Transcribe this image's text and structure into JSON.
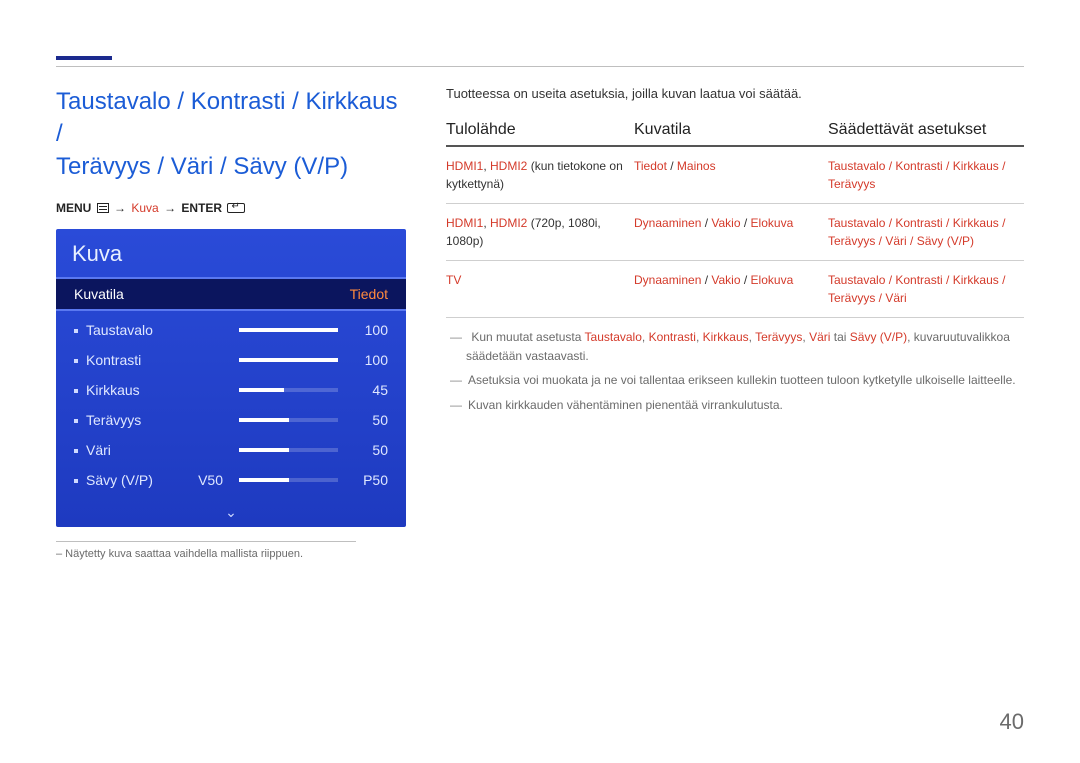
{
  "page_number": "40",
  "left": {
    "title_l1": "Taustavalo / Kontrasti / Kirkkaus /",
    "title_l2": "Terävyys / Väri / Sävy (V/P)",
    "menu_prefix": "MENU",
    "menu_mid": "Kuva",
    "menu_suffix": "ENTER",
    "arrow": "→"
  },
  "osd": {
    "title": "Kuva",
    "header_left": "Kuvatila",
    "header_right": "Tiedot",
    "items": [
      {
        "label": "Taustavalo",
        "pre": "",
        "value": "100",
        "pct": 100
      },
      {
        "label": "Kontrasti",
        "pre": "",
        "value": "100",
        "pct": 100
      },
      {
        "label": "Kirkkaus",
        "pre": "",
        "value": "45",
        "pct": 45
      },
      {
        "label": "Terävyys",
        "pre": "",
        "value": "50",
        "pct": 50
      },
      {
        "label": "Väri",
        "pre": "",
        "value": "50",
        "pct": 50
      },
      {
        "label": "Sävy (V/P)",
        "pre": "V50",
        "value": "P50",
        "pct": 50
      }
    ]
  },
  "panel_footnote": "– Näytetty kuva saattaa vaihdella mallista riippuen.",
  "right": {
    "intro": "Tuotteessa on useita asetuksia, joilla kuvan laatua voi säätää.",
    "headers": {
      "c1": "Tulolähde",
      "c2": "Kuvatila",
      "c3": "Säädettävät asetukset"
    },
    "rows": [
      {
        "c1_hl": "HDMI1",
        "c1_sep1": ", ",
        "c1_hl2": "HDMI2",
        "c1_rest": " (kun tietokone on kytkettynä)",
        "c2_a": "Tiedot",
        "c2_s1": " / ",
        "c2_b": "Mainos",
        "c2_s2": "",
        "c2_c": "",
        "c3": "Taustavalo / Kontrasti / Kirkkaus / Terävyys"
      },
      {
        "c1_hl": "HDMI1",
        "c1_sep1": ", ",
        "c1_hl2": "HDMI2",
        "c1_rest": " (720p, 1080i, 1080p)",
        "c2_a": "Dynaaminen",
        "c2_s1": " / ",
        "c2_b": "Vakio",
        "c2_s2": " / ",
        "c2_c": "Elokuva",
        "c3": "Taustavalo / Kontrasti / Kirkkaus / Terävyys / Väri / Sävy (V/P)"
      },
      {
        "c1_hl": "TV",
        "c1_sep1": "",
        "c1_hl2": "",
        "c1_rest": "",
        "c2_a": "Dynaaminen",
        "c2_s1": " / ",
        "c2_b": "Vakio",
        "c2_s2": " / ",
        "c2_c": "Elokuva",
        "c3": "Taustavalo / Kontrasti / Kirkkaus / Terävyys / Väri"
      }
    ],
    "notes": {
      "n1_a": "Kun muutat asetusta ",
      "n1_b": "Taustavalo",
      "n1_c": ", ",
      "n1_d": "Kontrasti",
      "n1_e": ", ",
      "n1_f": "Kirkkaus",
      "n1_g": ", ",
      "n1_h": "Terävyys",
      "n1_i": ", ",
      "n1_j": "Väri",
      "n1_k": " tai ",
      "n1_l": "Sävy (V/P)",
      "n1_m": ", kuvaruutuvalikkoa säädetään vastaavasti.",
      "n2": "Asetuksia voi muokata ja ne voi tallentaa erikseen kullekin tuotteen tuloon kytketylle ulkoiselle laitteelle.",
      "n3": "Kuvan kirkkauden vähentäminen pienentää virrankulutusta."
    }
  }
}
